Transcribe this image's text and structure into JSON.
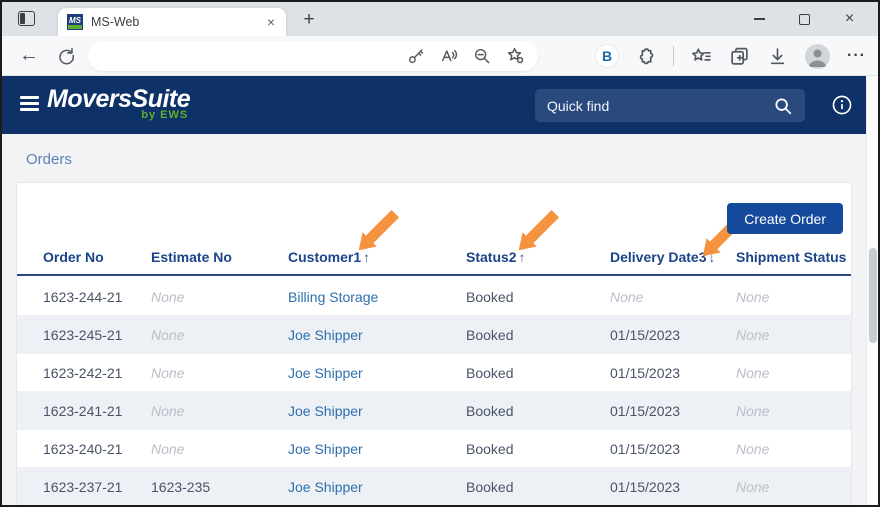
{
  "browser": {
    "titlebar": {
      "tab_title": "MS-Web",
      "favicon_text": "MS",
      "tab_close_glyph": "×",
      "new_tab_glyph": "+",
      "window_close_glyph": "×"
    },
    "toolbar": {
      "back_glyph": "←",
      "address_value": "",
      "extension_b_label": "B",
      "more_glyph": "···"
    }
  },
  "app": {
    "header": {
      "logo": "MoversSuite",
      "logo_byline": "by EWS",
      "quick_find_placeholder": "Quick find"
    },
    "page_title": "Orders",
    "create_order_label": "Create Order",
    "table": {
      "columns": [
        {
          "label": "Order No",
          "sort_badge": "",
          "sort_arrow": ""
        },
        {
          "label": "Estimate No",
          "sort_badge": "",
          "sort_arrow": ""
        },
        {
          "label": "Customer",
          "sort_badge": "1",
          "sort_arrow": "↑"
        },
        {
          "label": "Status",
          "sort_badge": "2",
          "sort_arrow": "↑"
        },
        {
          "label": "Delivery Date",
          "sort_badge": "3",
          "sort_arrow": "↓"
        },
        {
          "label": "Shipment Status",
          "sort_badge": "",
          "sort_arrow": ""
        }
      ],
      "rows": [
        {
          "order_no": "1623-244-21",
          "estimate_no": "None",
          "customer": "Billing Storage",
          "status": "Booked",
          "delivery_date": "None",
          "shipment_status": "None"
        },
        {
          "order_no": "1623-245-21",
          "estimate_no": "None",
          "customer": "Joe Shipper",
          "status": "Booked",
          "delivery_date": "01/15/2023",
          "shipment_status": "None"
        },
        {
          "order_no": "1623-242-21",
          "estimate_no": "None",
          "customer": "Joe Shipper",
          "status": "Booked",
          "delivery_date": "01/15/2023",
          "shipment_status": "None"
        },
        {
          "order_no": "1623-241-21",
          "estimate_no": "None",
          "customer": "Joe Shipper",
          "status": "Booked",
          "delivery_date": "01/15/2023",
          "shipment_status": "None"
        },
        {
          "order_no": "1623-240-21",
          "estimate_no": "None",
          "customer": "Joe Shipper",
          "status": "Booked",
          "delivery_date": "01/15/2023",
          "shipment_status": "None"
        },
        {
          "order_no": "1623-237-21",
          "estimate_no": "1623-235",
          "customer": "Joe Shipper",
          "status": "Booked",
          "delivery_date": "01/15/2023",
          "shipment_status": "None"
        }
      ]
    }
  },
  "colors": {
    "brand_navy": "#0e3167",
    "button_blue": "#15499c",
    "link_blue": "#2f6fad",
    "annotation_orange": "#f5923e"
  }
}
